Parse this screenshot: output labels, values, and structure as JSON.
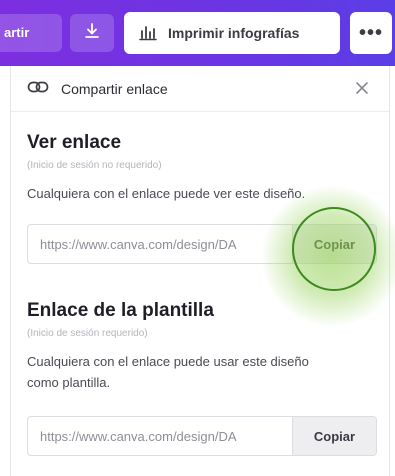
{
  "toolbar": {
    "share_label": "artir",
    "print_label": "Imprimir infografías",
    "more_label": "•••"
  },
  "panel": {
    "header_title": "Compartir enlace"
  },
  "view_link": {
    "title": "Ver enlace",
    "subtitle": "(Inicio de sesión no requerido)",
    "description": "Cualquiera con el enlace puede ver este diseño.",
    "url": "https://www.canva.com/design/DA",
    "copy_label": "Copiar"
  },
  "template_link": {
    "title": "Enlace de la plantilla",
    "subtitle": "(Inicio de sesión requerido)",
    "description": "Cualquiera con el enlace puede usar este diseño como plantilla.",
    "url": "https://www.canva.com/design/DA",
    "copy_label": "Copiar"
  },
  "colors": {
    "toolbar_start": "#7d2fe0",
    "toolbar_end": "#5b3ee6",
    "click_highlight": "#96d25a"
  },
  "icons": [
    "download-icon",
    "chart-icon",
    "link-icon",
    "close-icon"
  ]
}
